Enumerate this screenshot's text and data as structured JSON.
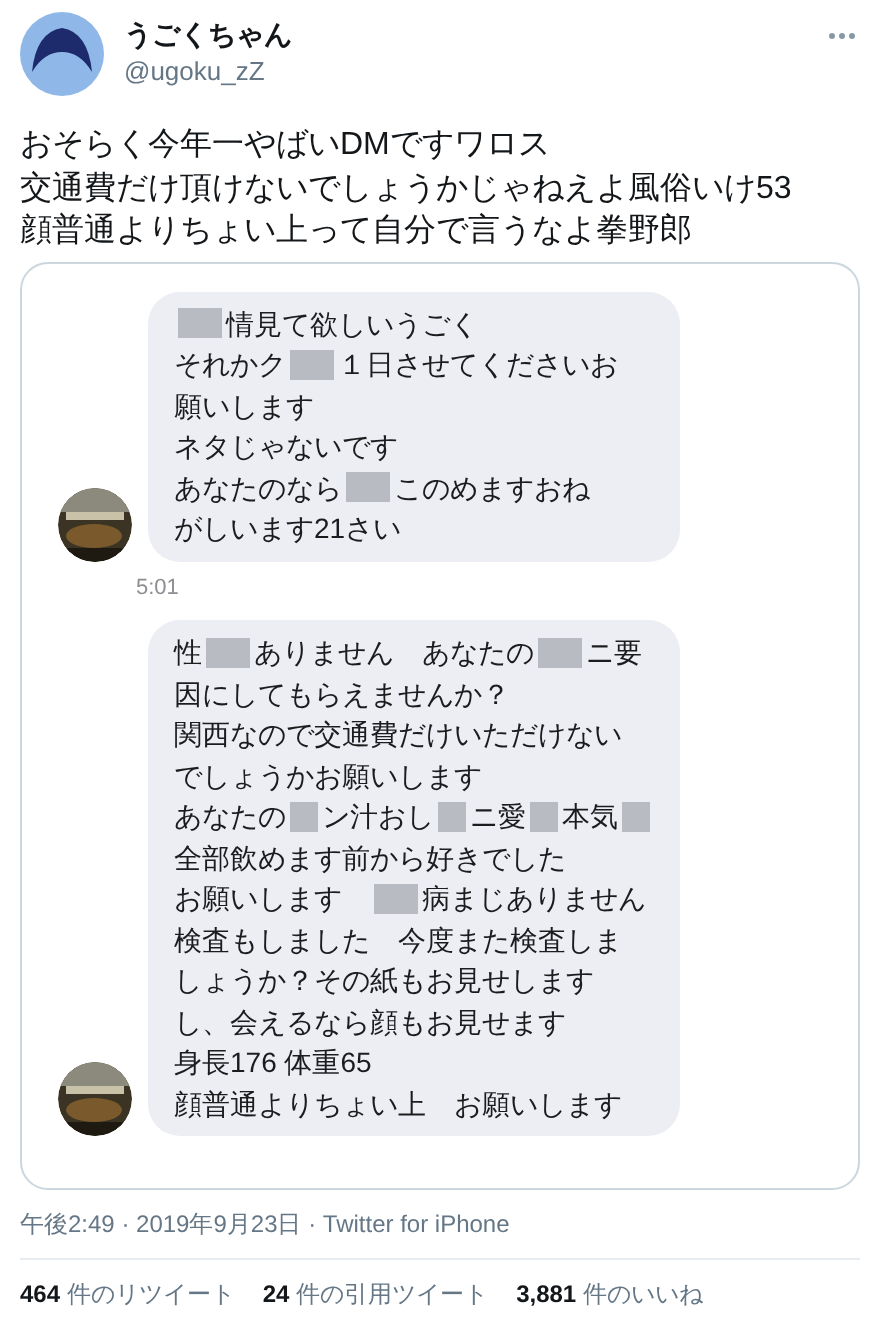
{
  "user": {
    "name": "うごくちゃん",
    "handle": "@ugoku_zZ"
  },
  "tweet_text": [
    "おそらく今年一やばいDMですワロス",
    "交通費だけ頂けないでしょうかじゃねえよ風俗いけ53",
    "顔普通よりちょい上って自分で言うなよ拳野郎"
  ],
  "messages": [
    {
      "lines": [
        [
          {
            "kind": "mosaic"
          },
          {
            "kind": "text",
            "text": "情見て欲しいうごく"
          }
        ],
        [
          {
            "kind": "text",
            "text": "それかク"
          },
          {
            "kind": "mosaic"
          },
          {
            "kind": "text",
            "text": "１日させてくださいお"
          }
        ],
        [
          {
            "kind": "text",
            "text": "願いします"
          }
        ],
        [
          {
            "kind": "text",
            "text": "ネタじゃないです"
          }
        ],
        [
          {
            "kind": "text",
            "text": "あなたのなら"
          },
          {
            "kind": "mosaic"
          },
          {
            "kind": "text",
            "text": "このめますおね"
          }
        ],
        [
          {
            "kind": "text",
            "text": "がしいます21さい"
          }
        ]
      ],
      "time": "5:01"
    },
    {
      "lines": [
        [
          {
            "kind": "text",
            "text": "性"
          },
          {
            "kind": "mosaic"
          },
          {
            "kind": "text",
            "text": "ありません　あなたの"
          },
          {
            "kind": "mosaic"
          },
          {
            "kind": "text",
            "text": "ニ要"
          }
        ],
        [
          {
            "kind": "text",
            "text": "因にしてもらえませんか？"
          }
        ],
        [
          {
            "kind": "text",
            "text": "関西なので交通費だけいただけない"
          }
        ],
        [
          {
            "kind": "text",
            "text": "でしょうかお願いします"
          }
        ],
        [
          {
            "kind": "text",
            "text": "あなたの"
          },
          {
            "kind": "mosaic"
          },
          {
            "kind": "text",
            "text": "ン汁おし"
          },
          {
            "kind": "mosaic"
          },
          {
            "kind": "text",
            "text": "ニ愛"
          },
          {
            "kind": "mosaic"
          },
          {
            "kind": "text",
            "text": "本気"
          },
          {
            "kind": "mosaic"
          }
        ],
        [
          {
            "kind": "text",
            "text": "全部飲めます前から好きでした"
          }
        ],
        [
          {
            "kind": "text",
            "text": "お願いします　"
          },
          {
            "kind": "mosaic"
          },
          {
            "kind": "text",
            "text": "病まじありません"
          }
        ],
        [
          {
            "kind": "text",
            "text": "検査もしました　今度また検査しま"
          }
        ],
        [
          {
            "kind": "text",
            "text": "しょうか？その紙もお見せします"
          }
        ],
        [
          {
            "kind": "text",
            "text": "し、会えるなら顔もお見せます"
          }
        ],
        [
          {
            "kind": "text",
            "text": "身長176 体重65"
          }
        ],
        [
          {
            "kind": "text",
            "text": "顔普通よりちょい上　お願いします"
          }
        ]
      ]
    }
  ],
  "timestamp": "午後2:49 · 2019年9月23日 · Twitter for iPhone",
  "stats": [
    {
      "count": "464",
      "label": "件のリツイート"
    },
    {
      "count": "24",
      "label": "件の引用ツイート"
    },
    {
      "count": "3,881",
      "label": "件のいいね"
    }
  ]
}
